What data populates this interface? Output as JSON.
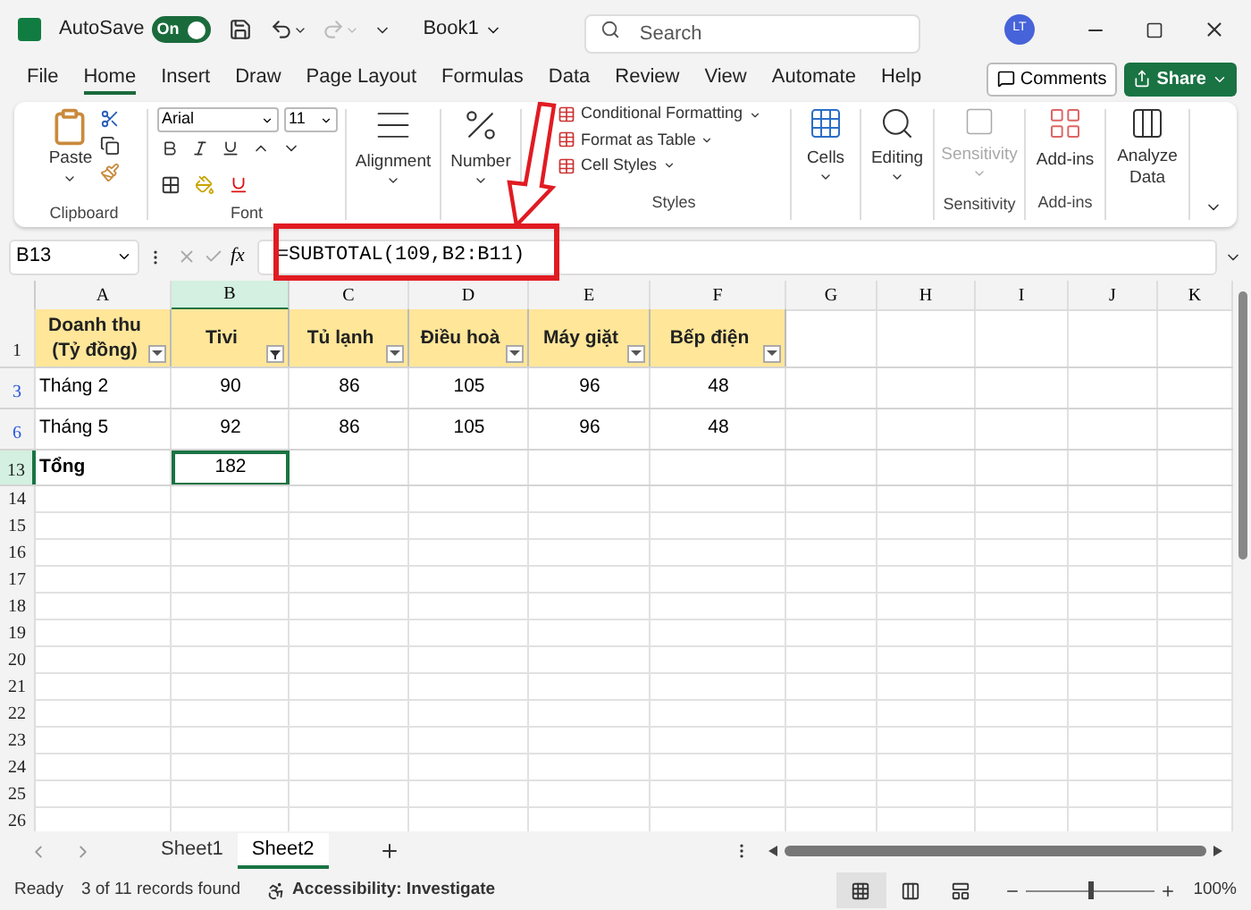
{
  "title_bar": {
    "autosave": {
      "label": "AutoSave",
      "on": true,
      "state_label": "On"
    },
    "title": "Book1",
    "search": {
      "placeholder": "Search"
    },
    "avatar": "LT"
  },
  "menu_tabs": [
    {
      "label": "File",
      "selected": false
    },
    {
      "label": "Home",
      "selected": true
    },
    {
      "label": "Insert",
      "selected": false
    },
    {
      "label": "Draw",
      "selected": false
    },
    {
      "label": "Page Layout",
      "selected": false
    },
    {
      "label": "Formulas",
      "selected": false
    },
    {
      "label": "Data",
      "selected": false
    },
    {
      "label": "Review",
      "selected": false
    },
    {
      "label": "View",
      "selected": false
    },
    {
      "label": "Automate",
      "selected": false
    },
    {
      "label": "Help",
      "selected": false
    }
  ],
  "comments_button": "Comments",
  "share_button": "Share",
  "ribbon": {
    "clipboard": {
      "paste": "Paste",
      "label": "Clipboard"
    },
    "font": {
      "name": "Arial",
      "size": "11",
      "label": "Font"
    },
    "alignment": "Alignment",
    "number": "Number",
    "styles": {
      "items": [
        "Conditional Formatting",
        "Format as Table",
        "Cell Styles"
      ],
      "label": "Styles"
    },
    "cells": "Cells",
    "editing": "Editing",
    "sensitivity": {
      "button": "Sensitivity",
      "disabled": true,
      "label": "Sensitivity"
    },
    "addins": {
      "button": "Add-ins",
      "label": "Add-ins"
    },
    "analyze": "Analyze Data"
  },
  "formula_bar": {
    "name_box": "B13",
    "function_label": "fx",
    "formula": "=SUBTOTAL(109,B2:B11)"
  },
  "sheet": {
    "columns": [
      {
        "label": "A",
        "selected": false
      },
      {
        "label": "B",
        "selected": true
      },
      {
        "label": "C",
        "selected": false
      },
      {
        "label": "D",
        "selected": false
      },
      {
        "label": "E",
        "selected": false
      },
      {
        "label": "F",
        "selected": false
      },
      {
        "label": "G",
        "selected": false
      },
      {
        "label": "H",
        "selected": false
      },
      {
        "label": "I",
        "selected": false
      },
      {
        "label": "J",
        "selected": false
      },
      {
        "label": "K",
        "selected": false
      }
    ],
    "rows": [
      {
        "number": "1",
        "kind": "header",
        "filtered": false,
        "selected": false,
        "cells": [
          {
            "text": "Doanh thu (Tỷ đồng)",
            "filter_active": false
          },
          {
            "text": "Tivi",
            "filter_active": true
          },
          {
            "text": "Tủ lạnh",
            "filter_active": false
          },
          {
            "text": "Điều hoà",
            "filter_active": false
          },
          {
            "text": "Máy giặt",
            "filter_active": false
          },
          {
            "text": "Bếp điện",
            "filter_active": false
          }
        ]
      },
      {
        "number": "3",
        "kind": "data",
        "filtered": true,
        "selected": false,
        "cells": [
          {
            "text": "Tháng 2"
          },
          {
            "text": "90"
          },
          {
            "text": "86"
          },
          {
            "text": "105"
          },
          {
            "text": "96"
          },
          {
            "text": "48"
          }
        ]
      },
      {
        "number": "6",
        "kind": "data",
        "filtered": true,
        "selected": false,
        "cells": [
          {
            "text": "Tháng 5"
          },
          {
            "text": "92"
          },
          {
            "text": "86"
          },
          {
            "text": "105"
          },
          {
            "text": "96"
          },
          {
            "text": "48"
          }
        ]
      },
      {
        "number": "13",
        "kind": "total",
        "filtered": false,
        "selected": true,
        "cells": [
          {
            "text": "Tổng"
          },
          {
            "text": "182"
          }
        ]
      }
    ],
    "empty_rows": [
      "14",
      "15",
      "16",
      "17",
      "18",
      "19",
      "20",
      "21",
      "22",
      "23",
      "24",
      "25",
      "26"
    ]
  },
  "sheet_tabs": [
    {
      "label": "Sheet1",
      "selected": false
    },
    {
      "label": "Sheet2",
      "selected": true
    }
  ],
  "status_bar": {
    "mode": "Ready",
    "filter_info": "3 of 11 records found",
    "accessibility": "Accessibility: Investigate",
    "view_buttons": [
      {
        "selected": true
      },
      {
        "selected": false
      },
      {
        "selected": false
      }
    ],
    "zoom": {
      "level": 0.5,
      "reading": "100%"
    }
  }
}
